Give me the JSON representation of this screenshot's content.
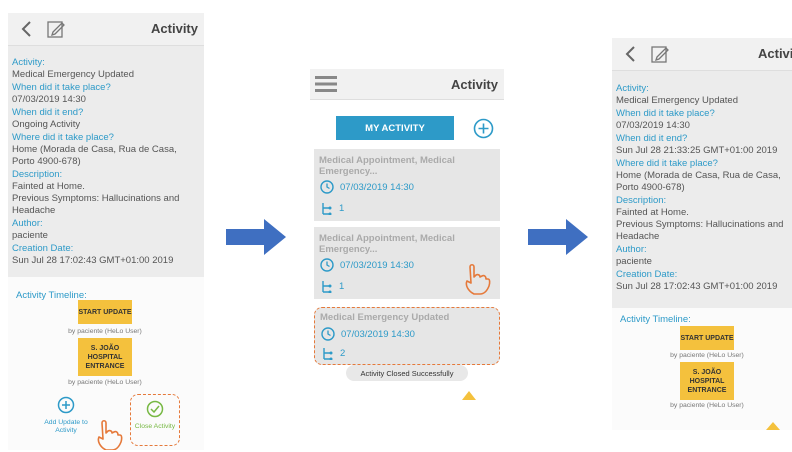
{
  "screen1": {
    "title": "Activity",
    "details": [
      {
        "label": "Activity:",
        "value": "Medical Emergency Updated"
      },
      {
        "label": "When did it take place?",
        "value": "07/03/2019 14:30"
      },
      {
        "label": "When did it end?",
        "value": "Ongoing Activity"
      },
      {
        "label": "Where did it take place?",
        "value": "Home (Morada de Casa, Rua de Casa, Porto 4900-678)"
      },
      {
        "label": "Description:",
        "value": "Fainted at Home.\nPrevious Symptoms: Hallucinations and Headache"
      },
      {
        "label": "Author:",
        "value": "paciente"
      },
      {
        "label": "Creation Date:",
        "value": "Sun Jul 28 17:02:43 GMT+01:00 2019"
      }
    ],
    "timeline_label": "Activity Timeline:",
    "timeline": [
      {
        "text": "START UPDATE",
        "by": "by paciente (HeLo User)"
      },
      {
        "text": "S. JOÃO HOSPITAL ENTRANCE",
        "by": "by paciente (HeLo User)"
      }
    ],
    "add_update_label": "Add Update to Activity",
    "close_activity_label": "Close Activity"
  },
  "screen2": {
    "title": "Activity",
    "my_activity_label": "MY ACTIVITY",
    "cards": [
      {
        "title": "Medical Appointment, Medical Emergency...",
        "date": "07/03/2019 14:30",
        "count": "1"
      },
      {
        "title": "Medical Appointment, Medical Emergency...",
        "date": "07/03/2019 14:30",
        "count": "1"
      },
      {
        "title": "Medical Emergency Updated",
        "date": "07/03/2019 14:30",
        "count": "2"
      }
    ],
    "toast": "Activity Closed Successfully"
  },
  "screen3": {
    "title": "Activit",
    "details": [
      {
        "label": "Activity:",
        "value": "Medical Emergency Updated"
      },
      {
        "label": "When did it take place?",
        "value": "07/03/2019 14:30"
      },
      {
        "label": "When did it end?",
        "value": "Sun Jul 28 21:33:25 GMT+01:00 2019"
      },
      {
        "label": "Where did it take place?",
        "value": "Home (Morada de Casa, Rua de Casa, Porto 4900-678)"
      },
      {
        "label": "Description:",
        "value": "Fainted at Home.\nPrevious Symptoms: Hallucinations and Headache"
      },
      {
        "label": "Author:",
        "value": "paciente"
      },
      {
        "label": "Creation Date:",
        "value": "Sun Jul 28 17:02:43 GMT+01:00 2019"
      }
    ],
    "timeline_label": "Activity Timeline:",
    "timeline": [
      {
        "text": "START UPDATE",
        "by": "by paciente (HeLo User)"
      },
      {
        "text": "S. JOÃO HOSPITAL ENTRANCE",
        "by": "by paciente (HeLo User)"
      }
    ]
  },
  "colors": {
    "accent": "#2d9ac8",
    "timeline_box": "#f4c13d",
    "arrow": "#3f6fc1",
    "hand": "#e5793a",
    "close_green": "#77b843"
  }
}
